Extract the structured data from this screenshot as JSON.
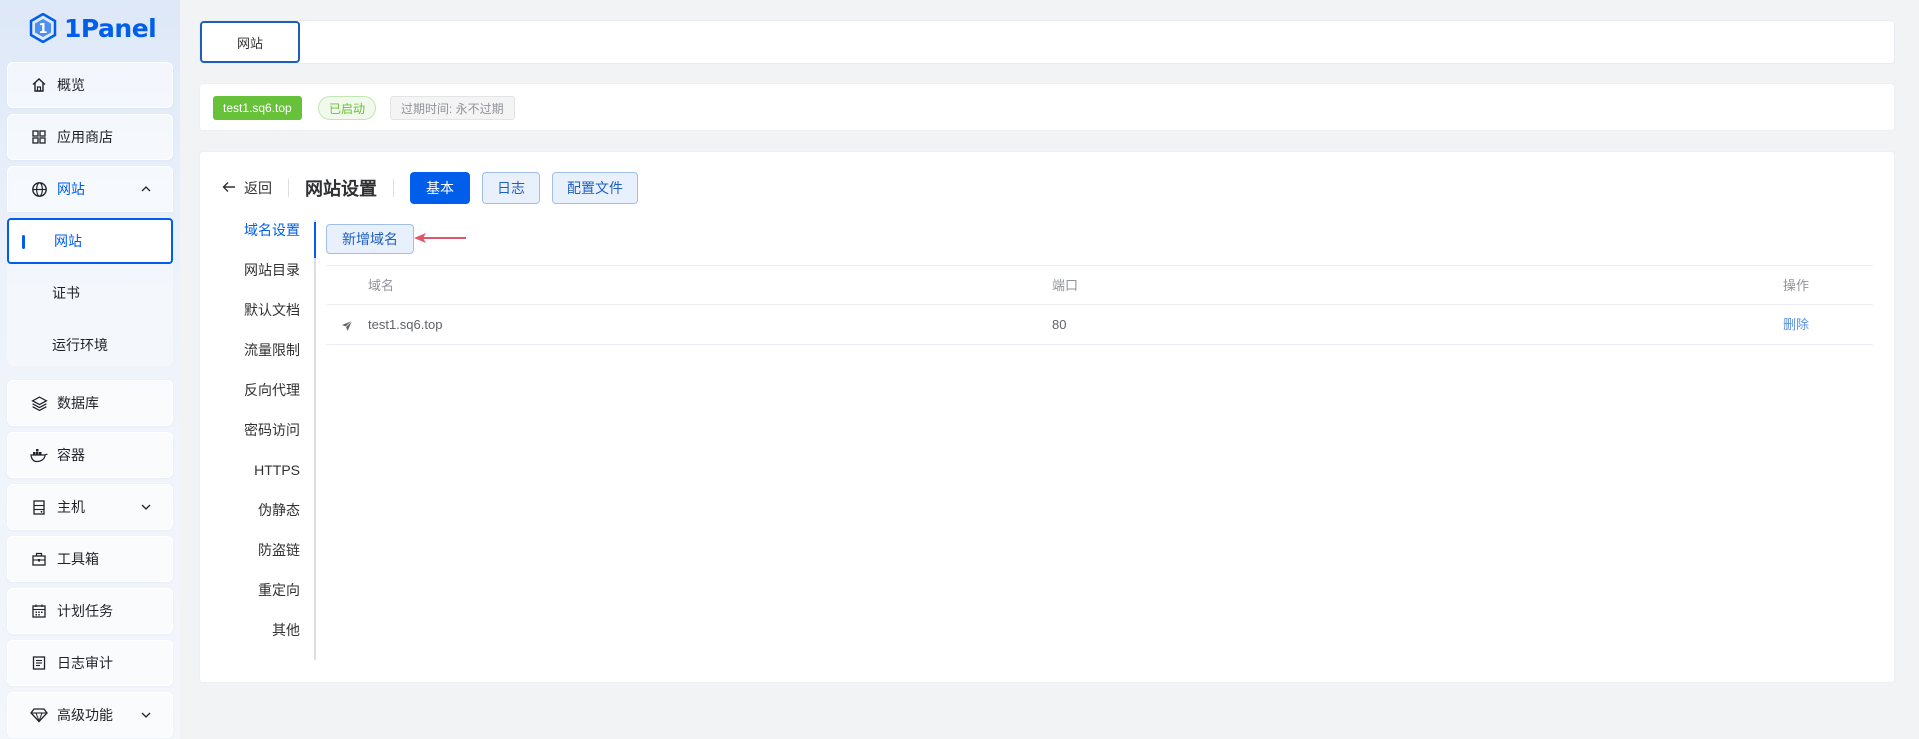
{
  "app": {
    "logo_text": "1Panel"
  },
  "sidebar": {
    "items": [
      {
        "label": "概览",
        "icon": "home-icon"
      },
      {
        "label": "应用商店",
        "icon": "grid-icon"
      },
      {
        "label": "网站",
        "icon": "globe-icon",
        "expanded": true,
        "children": [
          "网站",
          "证书",
          "运行环境"
        ]
      },
      {
        "label": "数据库",
        "icon": "layers-icon"
      },
      {
        "label": "容器",
        "icon": "docker-icon"
      },
      {
        "label": "主机",
        "icon": "server-icon"
      },
      {
        "label": "工具箱",
        "icon": "toolbox-icon"
      },
      {
        "label": "计划任务",
        "icon": "calendar-icon"
      },
      {
        "label": "日志审计",
        "icon": "log-icon"
      },
      {
        "label": "高级功能",
        "icon": "diamond-icon"
      }
    ]
  },
  "topbar": {
    "tab_label": "网站"
  },
  "site": {
    "domain_tag": "test1.sq6.top",
    "status": "已启动",
    "expire": "过期时间: 永不过期"
  },
  "panel": {
    "back_label": "返回",
    "title": "网站设置",
    "tabs": [
      "基本",
      "日志",
      "配置文件"
    ],
    "side_nav": [
      "域名设置",
      "网站目录",
      "默认文档",
      "流量限制",
      "反向代理",
      "密码访问",
      "HTTPS",
      "伪静态",
      "防盗链",
      "重定向",
      "其他"
    ],
    "add_domain_label": "新增域名",
    "table": {
      "headers": [
        "域名",
        "端口",
        "操作"
      ],
      "rows": [
        {
          "domain": "test1.sq6.top",
          "port": "80",
          "action": "删除"
        }
      ]
    }
  },
  "colors": {
    "primary": "#005eeb",
    "success": "#67c23a"
  }
}
